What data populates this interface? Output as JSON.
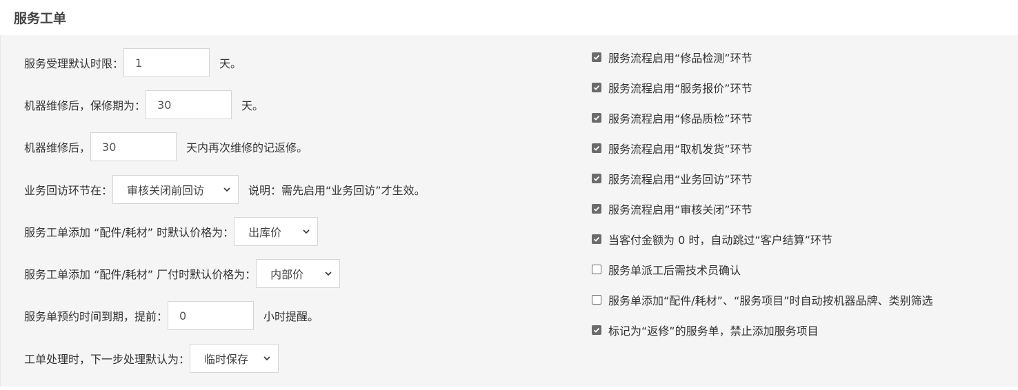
{
  "header": {
    "title": "服务工单"
  },
  "left": {
    "acceptance": {
      "label": "服务受理默认时限：",
      "value": "1",
      "suffix": "天。"
    },
    "warranty": {
      "label": "机器维修后，保修期为：",
      "value": "30",
      "suffix": "天。"
    },
    "rework": {
      "label": "机器维修后，",
      "value": "30",
      "suffix": "天内再次维修的记返修。"
    },
    "revisit": {
      "label": "业务回访环节在：",
      "selected": "审核关闭前回访",
      "note": "说明：需先启用“业务回访”才生效。"
    },
    "parts_price": {
      "label": "服务工单添加 “配件/耗材” 时默认价格为：",
      "selected": "出库价"
    },
    "factory_price": {
      "label": "服务工单添加 “配件/耗材” 厂付时默认价格为：",
      "selected": "内部价"
    },
    "appointment": {
      "label": "服务单预约时间到期，提前：",
      "value": "0",
      "suffix": "小时提醒。"
    },
    "next_step": {
      "label": "工单处理时，下一步处理默认为：",
      "selected": "临时保存"
    }
  },
  "right": {
    "options": [
      {
        "label": "服务流程启用“修品检测”环节",
        "checked": true
      },
      {
        "label": "服务流程启用“服务报价”环节",
        "checked": true
      },
      {
        "label": "服务流程启用“修品质检”环节",
        "checked": true
      },
      {
        "label": "服务流程启用“取机发货”环节",
        "checked": true
      },
      {
        "label": "服务流程启用“业务回访”环节",
        "checked": true
      },
      {
        "label": "服务流程启用“审核关闭”环节",
        "checked": true
      },
      {
        "label": "当客付金额为 0 时，自动跳过“客户结算”环节",
        "checked": true
      },
      {
        "label": "服务单派工后需技术员确认",
        "checked": false
      },
      {
        "label": "服务单添加“配件/耗材”、“服务项目”时自动按机器品牌、类别筛选",
        "checked": false
      },
      {
        "label": "标记为“返修”的服务单，禁止添加服务项目",
        "checked": true
      }
    ]
  },
  "colors": {
    "panel_bg": "#f5f5f5",
    "checkbox_checked": "#6b6b6b",
    "border": "#d6d6d6"
  }
}
